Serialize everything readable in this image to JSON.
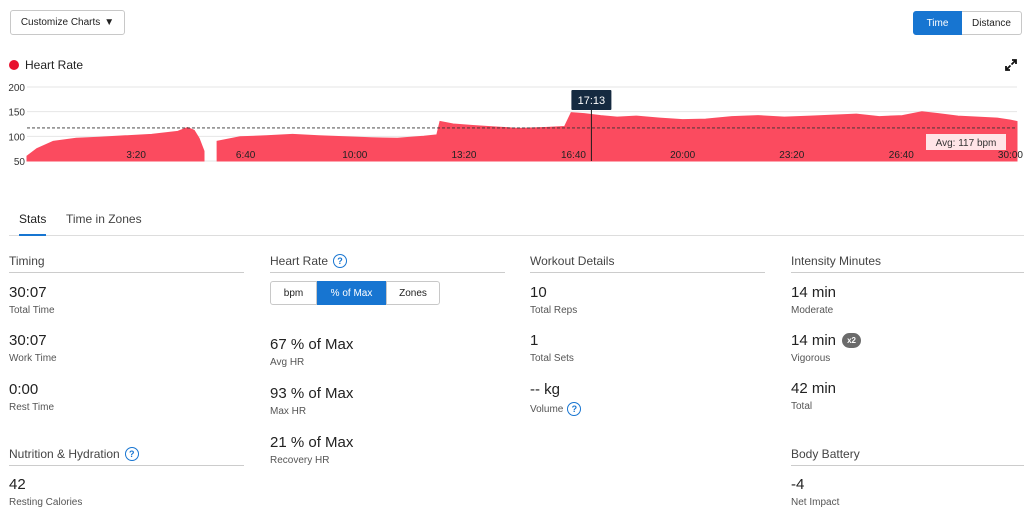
{
  "toolbar": {
    "customize_label": "Customize Charts",
    "toggle": [
      {
        "label": "Time",
        "active": true
      },
      {
        "label": "Distance",
        "active": false
      }
    ]
  },
  "legend": {
    "label": "Heart Rate",
    "color": "#e8112d"
  },
  "chart_data": {
    "type": "area",
    "series": [
      {
        "name": "Heart Rate",
        "color": "#fb4b5f"
      }
    ],
    "x_unit": "minutes",
    "xlim": [
      0,
      30.2
    ],
    "ylim": [
      50,
      200
    ],
    "yticks": [
      "200",
      "150",
      "100",
      "50"
    ],
    "xticks": [
      {
        "t": 3.33,
        "label": "3:20"
      },
      {
        "t": 6.67,
        "label": "6:40"
      },
      {
        "t": 10.0,
        "label": "10:00"
      },
      {
        "t": 13.33,
        "label": "13:20"
      },
      {
        "t": 16.67,
        "label": "16:40"
      },
      {
        "t": 20.0,
        "label": "20:00"
      },
      {
        "t": 23.33,
        "label": "23:20"
      },
      {
        "t": 26.67,
        "label": "26:40"
      },
      {
        "t": 30.0,
        "label": "30:00"
      }
    ],
    "x": [
      0,
      0.3,
      0.8,
      1.5,
      2.2,
      3.0,
      3.8,
      4.6,
      4.9,
      5.1,
      5.25,
      5.4,
      5.5,
      5.75,
      5.8,
      6.5,
      7.3,
      8.1,
      8.9,
      9.7,
      10.5,
      11.3,
      12.1,
      12.5,
      12.6,
      13.0,
      13.6,
      14.3,
      15.0,
      15.8,
      16.4,
      16.6,
      17.0,
      17.5,
      18.0,
      18.6,
      19.3,
      20.0,
      20.7,
      21.5,
      22.3,
      23.1,
      23.9,
      24.6,
      25.3,
      26.0,
      26.7,
      27.3,
      27.8,
      28.4,
      29.0,
      29.6,
      30.0,
      30.2
    ],
    "values": [
      60,
      75,
      90,
      96,
      98,
      101,
      104,
      110,
      118,
      112,
      96,
      70,
      null,
      null,
      90,
      99,
      101,
      104,
      101,
      99,
      97,
      96,
      100,
      103,
      130,
      125,
      122,
      119,
      116,
      118,
      120,
      148,
      146,
      142,
      139,
      141,
      137,
      134,
      135,
      140,
      142,
      139,
      141,
      143,
      145,
      140,
      142,
      150,
      146,
      141,
      139,
      137,
      133,
      130
    ],
    "avg_label": "Avg: 117 bpm",
    "avg_value": 117,
    "cursor_t": 17.217,
    "cursor_label": "17:13"
  },
  "tabs": [
    {
      "label": "Stats",
      "active": true
    },
    {
      "label": "Time in Zones",
      "active": false
    }
  ],
  "timing": {
    "title": "Timing",
    "stats": [
      {
        "value": "30:07",
        "label": "Total Time"
      },
      {
        "value": "30:07",
        "label": "Work Time"
      },
      {
        "value": "0:00",
        "label": "Rest Time"
      }
    ]
  },
  "nutrition": {
    "title": "Nutrition & Hydration",
    "stats": [
      {
        "value": "42",
        "label": "Resting Calories"
      }
    ]
  },
  "heart_rate": {
    "title": "Heart Rate",
    "toggle": [
      {
        "label": "bpm",
        "active": false
      },
      {
        "label": "% of Max",
        "active": true
      },
      {
        "label": "Zones",
        "active": false
      }
    ],
    "stats": [
      {
        "value": "67 % of Max",
        "label": "Avg HR"
      },
      {
        "value": "93 % of Max",
        "label": "Max HR"
      },
      {
        "value": "21 % of Max",
        "label": "Recovery HR"
      }
    ]
  },
  "workout": {
    "title": "Workout Details",
    "stats": [
      {
        "value": "10",
        "label": "Total Reps"
      },
      {
        "value": "1",
        "label": "Total Sets"
      },
      {
        "value": "-- kg",
        "label": "Volume"
      }
    ]
  },
  "intensity": {
    "title": "Intensity Minutes",
    "stats": [
      {
        "value": "14 min",
        "label": "Moderate"
      },
      {
        "value": "14 min",
        "label": "Vigorous",
        "badge": "x2"
      },
      {
        "value": "42 min",
        "label": "Total"
      }
    ]
  },
  "body_battery": {
    "title": "Body Battery",
    "stats": [
      {
        "value": "-4",
        "label": "Net Impact"
      }
    ]
  }
}
